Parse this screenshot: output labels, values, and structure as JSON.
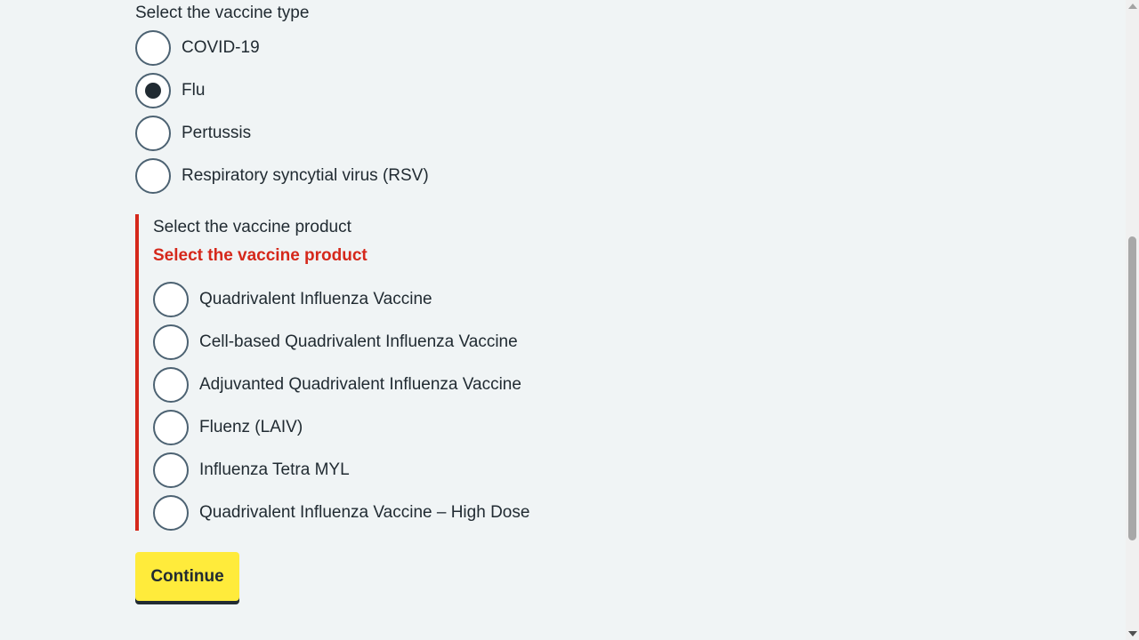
{
  "vaccine_type": {
    "legend": "Select the vaccine type",
    "options": [
      {
        "label": "COVID-19",
        "checked": false
      },
      {
        "label": "Flu",
        "checked": true
      },
      {
        "label": "Pertussis",
        "checked": false
      },
      {
        "label": "Respiratory syncytial virus (RSV)",
        "checked": false
      }
    ]
  },
  "vaccine_product": {
    "legend": "Select the vaccine product",
    "error": "Select the vaccine product",
    "options": [
      {
        "label": "Quadrivalent Influenza Vaccine",
        "checked": false
      },
      {
        "label": "Cell-based Quadrivalent Influenza Vaccine",
        "checked": false
      },
      {
        "label": "Adjuvanted Quadrivalent Influenza Vaccine",
        "checked": false
      },
      {
        "label": "Fluenz (LAIV)",
        "checked": false
      },
      {
        "label": "Influenza Tetra MYL",
        "checked": false
      },
      {
        "label": "Quadrivalent Influenza Vaccine – High Dose",
        "checked": false
      }
    ]
  },
  "continue_label": "Continue",
  "colors": {
    "background": "#f0f4f5",
    "error": "#d5281b",
    "button": "#ffeb3b",
    "text": "#212b32"
  }
}
